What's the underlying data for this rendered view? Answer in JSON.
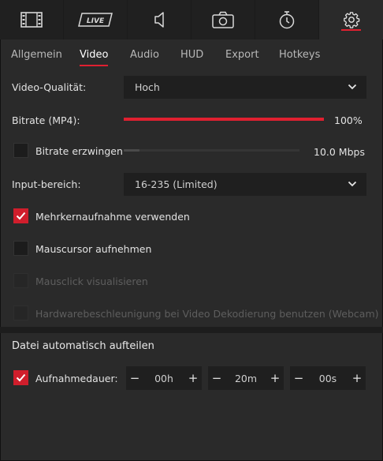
{
  "toolbar": {
    "tabs": [
      {
        "name": "film-icon"
      },
      {
        "name": "live-icon",
        "text": "LIVE"
      },
      {
        "name": "audio-icon"
      },
      {
        "name": "camera-icon"
      },
      {
        "name": "timer-icon"
      },
      {
        "name": "gear-icon"
      }
    ],
    "active_index": 5
  },
  "subtabs": [
    "Allgemein",
    "Video",
    "Audio",
    "HUD",
    "Export",
    "Hotkeys"
  ],
  "active_subtab": "Video",
  "video_quality": {
    "label": "Video-Qualität:",
    "value": "Hoch"
  },
  "bitrate": {
    "label": "Bitrate (MP4):",
    "value_text": "100%",
    "level": 1.0
  },
  "force_bitrate": {
    "label": "Bitrate erzwingen",
    "checked": false,
    "value_text": "10.0 Mbps",
    "level": 0.0
  },
  "input_range": {
    "label": "Input-bereich:",
    "value": "16-235 (Limited)"
  },
  "options": [
    {
      "label": "Mehrkernaufnahme verwenden",
      "checked": true,
      "disabled": false
    },
    {
      "label": "Mauscursor aufnehmen",
      "checked": false,
      "disabled": false
    },
    {
      "label": "Mausclick visualisieren",
      "checked": false,
      "disabled": true
    },
    {
      "label": "Hardwarebeschleunigung bei Video Dekodierung benutzen (Webcam)",
      "checked": false,
      "disabled": true
    }
  ],
  "split": {
    "title": "Datei automatisch aufteilen",
    "duration_label": "Aufnahmedauer:",
    "duration_checked": true,
    "hours": "00h",
    "minutes": "20m",
    "seconds": "00s",
    "minus": "−",
    "plus": "+"
  },
  "colors": {
    "accent": "#e02030",
    "background": "#2a2a2a",
    "field": "#1f1f1f"
  }
}
